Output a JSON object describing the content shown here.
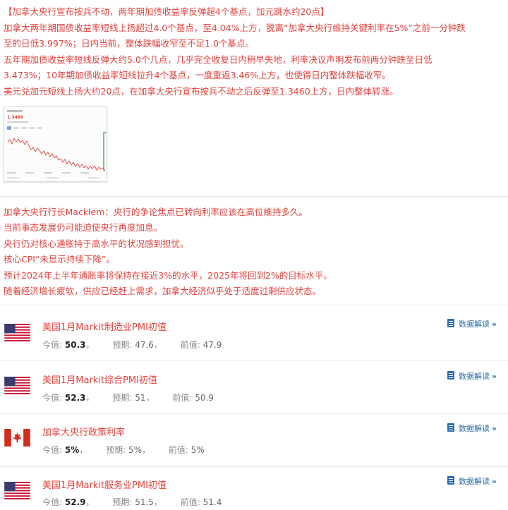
{
  "news": {
    "lines": [
      "【加拿大央行宣布按兵不动，两年期加债收益率反弹超4个基点，加元跳水约20点】",
      "加拿大两年期国债收益率短线上扬超过4.0个基点，至4.04%上方，脱离“加拿大央行维持关键利率在5%”之前一分钟跌",
      "至的日低3.997%；日内当前，整体跌幅收窄至不足1.0个基点。",
      "五年期加债收益率短线反弹大约5.0个几点，几乎完全收复日内稍早失地，利率决议声明发布前两分钟跌至日低",
      "3.473%；10年期加债收益率短线拉升4个基点，一度重返3.46%上方，也使得日内整体跌幅收窄。",
      "美元兑加元短线上扬大约20点，在加拿大央行宣布按兵不动之后反弹至1.3460上方，日内整体转涨。"
    ]
  },
  "chart_thumb": {
    "price_label": "1.3460",
    "line_color": "#e8413c",
    "spike_color": "#2e9a3a"
  },
  "speech": {
    "lines": [
      "加拿大央行行长Macklem：央行的争论焦点已转向利率应该在高位维持多久。",
      "当前事态发展仍可能迫使央行再度加息。",
      "央行仍对核心通胀持于高水平的状况感到担忧。",
      "核心CPI“未显示持续下降”。",
      "预计2024年上半年通胀率将保持在接近3%的水平，2025年将回到2%的目标水平。",
      "随着经济增长疲软，供应已经赶上需求，加拿大经济似乎处于适度过剩供应状态。"
    ]
  },
  "events": [
    {
      "flag": "us-flag",
      "title": "美国1月Markit制造业PMI初值",
      "actual_label": "今值:",
      "actual": "50.3",
      "forecast_label": "预期:",
      "forecast": "47.6",
      "previous_label": "前值:",
      "previous": "47.9",
      "interp_label": "数据解读"
    },
    {
      "flag": "us-flag",
      "title": "美国1月Markit综合PMI初值",
      "actual_label": "今值:",
      "actual": "52.3",
      "forecast_label": "预期:",
      "forecast": "51",
      "previous_label": "前值:",
      "previous": "50.9",
      "interp_label": "数据解读"
    },
    {
      "flag": "canada-flag",
      "title": "加拿大央行政策利率",
      "actual_label": "今值:",
      "actual": "5%",
      "forecast_label": "预期:",
      "forecast": "5%",
      "previous_label": "前值:",
      "previous": "5%",
      "interp_label": "数据解读"
    },
    {
      "flag": "us-flag",
      "title": "美国1月Markit服务业PMI初值",
      "actual_label": "今值:",
      "actual": "52.9",
      "forecast_label": "预期:",
      "forecast": "51.5",
      "previous_label": "前值:",
      "previous": "51.4",
      "interp_label": "数据解读"
    }
  ]
}
